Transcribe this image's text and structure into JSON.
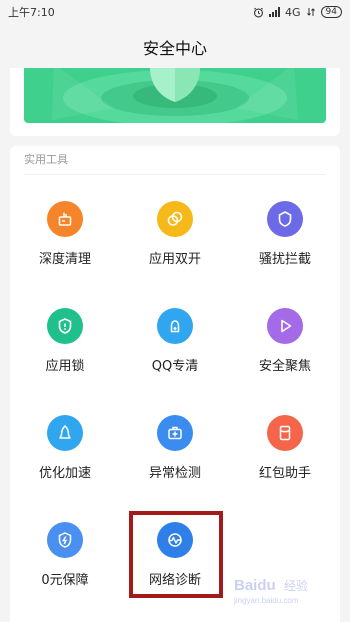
{
  "status_bar": {
    "time": "上午7:10",
    "network": "4G",
    "battery": "94",
    "alarm_icon": "alarm-icon",
    "signal_icon": "signal-icon"
  },
  "header": {
    "title": "安全中心"
  },
  "banner": {
    "accent_color": "#3fd08e",
    "image": "shield-illustration"
  },
  "tools": {
    "section_title": "实用工具",
    "items": [
      {
        "label": "深度清理",
        "icon": "broom-icon",
        "color": "#f5842a"
      },
      {
        "label": "应用双开",
        "icon": "dual-circle-icon",
        "color": "#f7b81a"
      },
      {
        "label": "骚扰拦截",
        "icon": "shield-icon",
        "color": "#6d6ae8"
      },
      {
        "label": "应用锁",
        "icon": "lock-shield-icon",
        "color": "#20c08c"
      },
      {
        "label": "QQ专清",
        "icon": "qq-clean-icon",
        "color": "#2fa6ef"
      },
      {
        "label": "安全聚焦",
        "icon": "play-icon",
        "color": "#a46ae8"
      },
      {
        "label": "优化加速",
        "icon": "rocket-icon",
        "color": "#2fa6ef"
      },
      {
        "label": "异常检测",
        "icon": "medkit-icon",
        "color": "#3b8cf0"
      },
      {
        "label": "红包助手",
        "icon": "envelope-icon",
        "color": "#f4654a"
      },
      {
        "label": "0元保障",
        "icon": "bolt-shield-icon",
        "color": "#4a90f0"
      },
      {
        "label": "网络诊断",
        "icon": "network-wave-icon",
        "color": "#2e7fe8"
      }
    ]
  },
  "watermark": {
    "brand_text": "Baidu",
    "sub_text": "经验",
    "url": "jingyan.baidu.com"
  },
  "highlight": {
    "target": "网络诊断",
    "color": "#a31a1a"
  }
}
